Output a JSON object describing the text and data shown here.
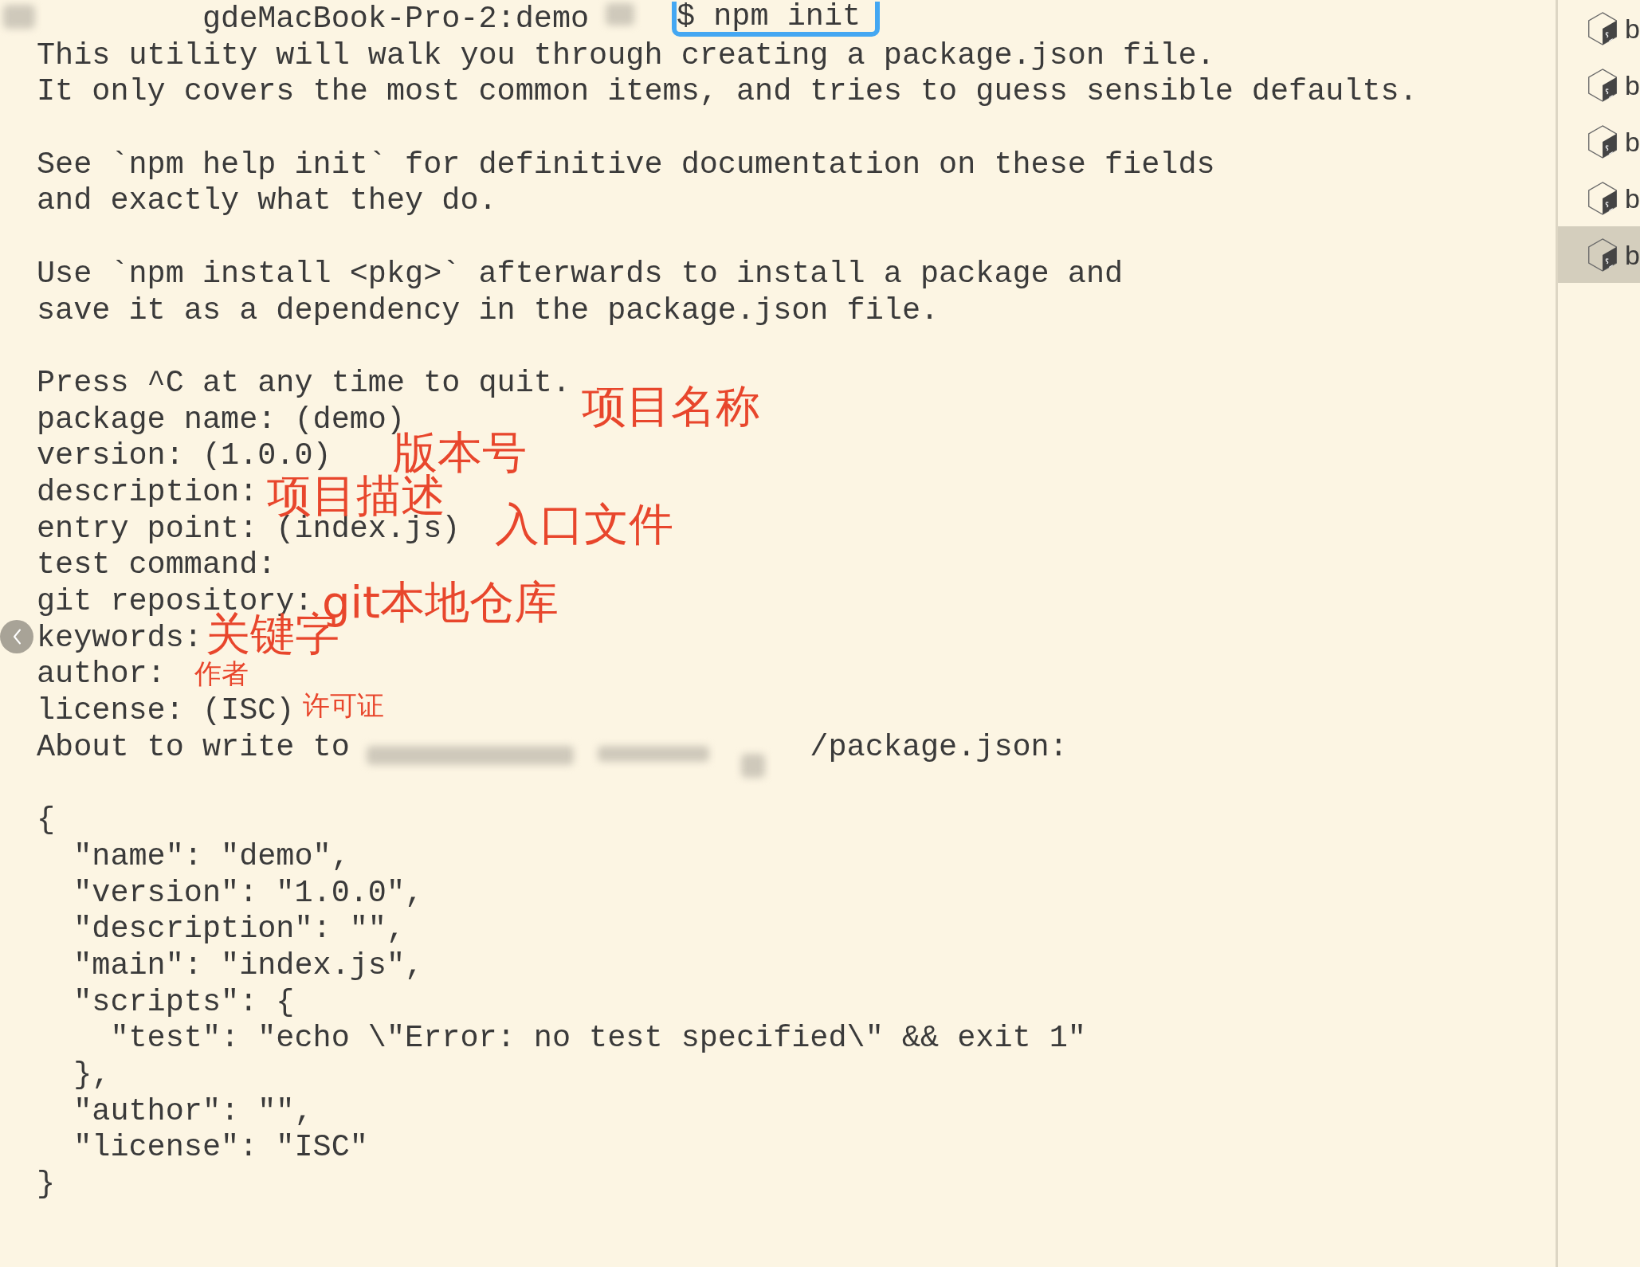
{
  "terminal": {
    "lines": [
      {
        "kind": "prompt",
        "host": "gdeMacBook-Pro-2:demo",
        "command": "$ npm init"
      },
      {
        "kind": "text",
        "text": "This utility will walk you through creating a package.json file."
      },
      {
        "kind": "text",
        "text": "It only covers the most common items, and tries to guess sensible defaults."
      },
      {
        "kind": "blank"
      },
      {
        "kind": "text",
        "text": "See `npm help init` for definitive documentation on these fields"
      },
      {
        "kind": "text",
        "text": "and exactly what they do."
      },
      {
        "kind": "blank"
      },
      {
        "kind": "text",
        "text": "Use `npm install <pkg>` afterwards to install a package and"
      },
      {
        "kind": "text",
        "text": "save it as a dependency in the package.json file."
      },
      {
        "kind": "blank"
      },
      {
        "kind": "text",
        "text": "Press ^C at any time to quit."
      },
      {
        "kind": "text",
        "text": "package name: (demo)"
      },
      {
        "kind": "text",
        "text": "version: (1.0.0)"
      },
      {
        "kind": "text",
        "text": "description:"
      },
      {
        "kind": "text",
        "text": "entry point: (index.js)"
      },
      {
        "kind": "text",
        "text": "test command:"
      },
      {
        "kind": "text",
        "text": "git repository:"
      },
      {
        "kind": "text",
        "text": "keywords:"
      },
      {
        "kind": "text",
        "text": "author:"
      },
      {
        "kind": "text",
        "text": "license: (ISC)"
      },
      {
        "kind": "path",
        "prefix": "About to write to",
        "suffix": "/package.json:"
      },
      {
        "kind": "blank"
      },
      {
        "kind": "text",
        "text": "{"
      },
      {
        "kind": "text",
        "text": "  \"name\": \"demo\","
      },
      {
        "kind": "text",
        "text": "  \"version\": \"1.0.0\","
      },
      {
        "kind": "text",
        "text": "  \"description\": \"\","
      },
      {
        "kind": "text",
        "text": "  \"main\": \"index.js\","
      },
      {
        "kind": "text",
        "text": "  \"scripts\": {"
      },
      {
        "kind": "text",
        "text": "    \"test\": \"echo \\\"Error: no test specified\\\" && exit 1\""
      },
      {
        "kind": "text",
        "text": "  },"
      },
      {
        "kind": "text",
        "text": "  \"author\": \"\","
      },
      {
        "kind": "text",
        "text": "  \"license\": \"ISC\""
      },
      {
        "kind": "text",
        "text": "}"
      }
    ]
  },
  "annotations": [
    {
      "text": "项目名称"
    },
    {
      "text": "版本号"
    },
    {
      "text": "项目描述"
    },
    {
      "text": "入口文件"
    },
    {
      "text": "git本地仓库"
    },
    {
      "text": "关键字"
    },
    {
      "text": "作者"
    },
    {
      "text": "许可证"
    }
  ],
  "sidebar": {
    "items": [
      {
        "label": "b",
        "selected": false
      },
      {
        "label": "b",
        "selected": false
      },
      {
        "label": "b",
        "selected": false
      },
      {
        "label": "b",
        "selected": false
      },
      {
        "label": "b",
        "selected": true
      }
    ]
  }
}
